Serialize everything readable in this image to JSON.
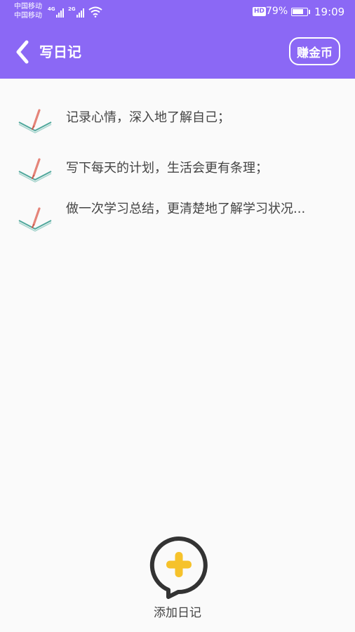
{
  "status_bar": {
    "carrier_1": "中国移动",
    "carrier_2": "中国移动",
    "network_1": "4G",
    "network_2": "2G",
    "hd_badge": "HD",
    "battery_percent": "79%",
    "battery_level": 0.79,
    "time": "19:09"
  },
  "header": {
    "title": "写日记",
    "earn_button": "赚金币",
    "background_color": "#8b68f5"
  },
  "tips": [
    {
      "text": "记录心情，深入地了解自己；",
      "icon": "notebook-pencil-icon"
    },
    {
      "text": "写下每天的计划，生活会更有条理；",
      "icon": "notebook-pencil-icon"
    },
    {
      "text": "做一次学习总结，更清楚地了解学习状况...",
      "icon": "notebook-pencil-icon"
    }
  ],
  "add_diary": {
    "label": "添加日记",
    "icon": "add-speech-bubble-icon",
    "accent_color": "#f6c22b"
  }
}
